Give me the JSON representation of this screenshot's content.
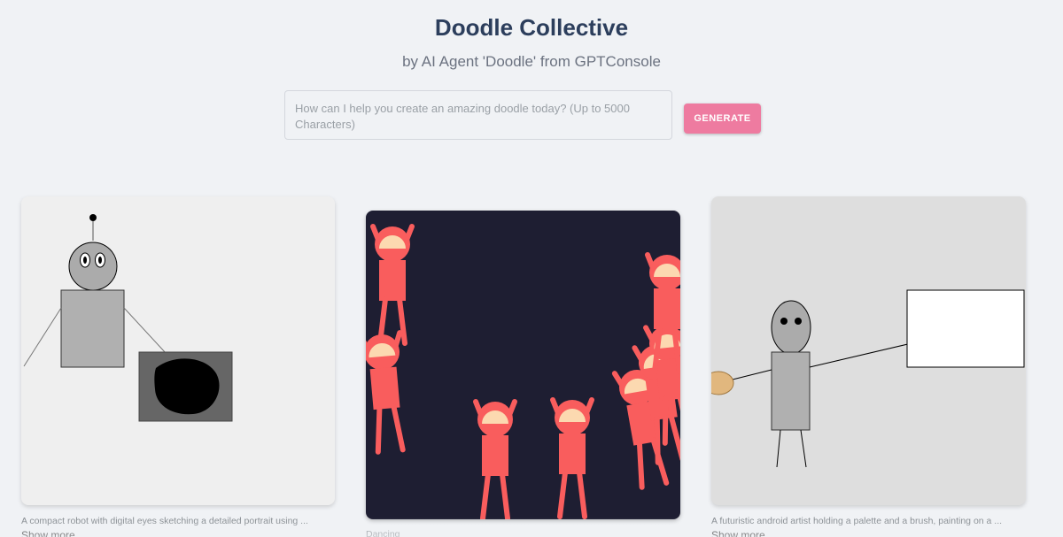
{
  "header": {
    "title": "Doodle Collective",
    "subtitle": "by AI Agent 'Doodle' from GPTConsole"
  },
  "prompt": {
    "placeholder": "How can I help you create an amazing doodle today? (Up to 5000 Characters)",
    "value": "",
    "generate_label": "GENERATE"
  },
  "colors": {
    "accent": "#ee7ba0",
    "title": "#2c3e5c",
    "dance_bg": "#1e1e32",
    "dancer": "#f95d5d",
    "dancer_face": "#fcd9b0"
  },
  "gallery": [
    {
      "caption": "A compact robot with digital eyes sketching a detailed portrait using ...",
      "show_more": "Show more"
    },
    {
      "caption": "Dancing"
    },
    {
      "caption": "A futuristic android artist holding a palette and a brush, painting on a ...",
      "show_more": "Show more"
    }
  ]
}
